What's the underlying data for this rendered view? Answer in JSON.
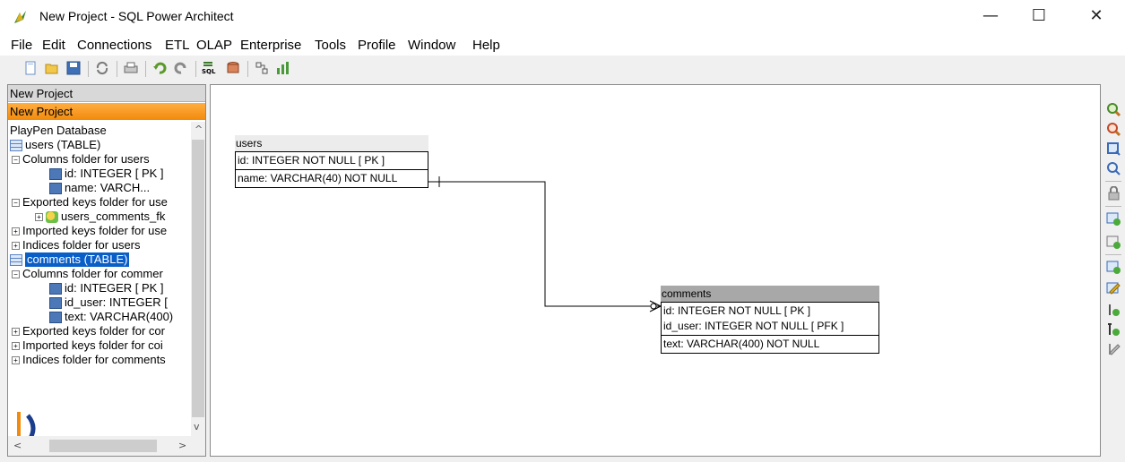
{
  "window": {
    "title": "New Project - SQL Power Architect",
    "minimize": "—",
    "maximize": "☐",
    "close": "✕"
  },
  "menubar": {
    "items": [
      {
        "label": "File"
      },
      {
        "label": "Edit"
      },
      {
        "label": "Connections"
      },
      {
        "label": "ETL"
      },
      {
        "label": "OLAP"
      },
      {
        "label": "Enterprise"
      },
      {
        "label": "Tools"
      },
      {
        "label": "Profile"
      },
      {
        "label": "Window"
      },
      {
        "label": "Help"
      }
    ]
  },
  "toolbar": {
    "buttons": [
      "new-project-icon",
      "open-project-icon",
      "save-project-icon",
      "refresh-icon",
      "print-icon",
      "undo-icon",
      "redo-icon",
      "forward-engineer-sql-icon",
      "compare-dm-icon",
      "export-csv-icon",
      "data-mover-icon"
    ]
  },
  "projects": {
    "first": "New Project",
    "second": "New Project"
  },
  "tree": {
    "root": "PlayPen Database",
    "users_table": "users (TABLE)",
    "users_columns_folder": "Columns folder for users",
    "users_col_id": "id: INTEGER  [ PK ]",
    "users_col_name": "name: VARCH...",
    "users_exported": "Exported keys folder for use",
    "users_fk": "users_comments_fk",
    "users_imported": "Imported keys folder for use",
    "users_indices": "Indices folder for users",
    "comments_table": "comments (TABLE)",
    "comments_columns_folder": "Columns folder for commer",
    "comments_col_id": "id: INTEGER  [ PK ]",
    "comments_col_id_user": "id_user: INTEGER  [",
    "comments_col_text": "text: VARCHAR(400)",
    "comments_exported": "Exported keys folder for cor",
    "comments_imported": "Imported keys folder for coi",
    "comments_indices": "Indices folder for comments"
  },
  "playpen": {
    "users": {
      "name": "users",
      "pk": [
        "id: INTEGER   NOT NULL  [ PK ]"
      ],
      "cols": [
        "name: VARCHAR(40)   NOT NULL"
      ]
    },
    "comments": {
      "name": "comments",
      "pk": [
        "id: INTEGER   NOT NULL  [ PK ]",
        "id_user: INTEGER   NOT NULL  [ PFK ]"
      ],
      "cols": [
        "text: VARCHAR(400)   NOT NULL"
      ]
    }
  },
  "right_toolbar": {
    "buttons": [
      "zoom-in-icon",
      "zoom-out-icon",
      "zoom-fit-icon",
      "zoom-reset-icon",
      "select-all-icon",
      "new-table-icon",
      "new-column-icon",
      "insert-column-icon",
      "edit-table-icon",
      "new-identifying-relationship-icon",
      "new-relationship-icon",
      "edit-relationship-icon"
    ]
  },
  "colors": {
    "selected_project": "#f28a0c",
    "selection": "#0a5ec7",
    "users_header": "#ececec",
    "comments_header": "#a8a8a8"
  }
}
